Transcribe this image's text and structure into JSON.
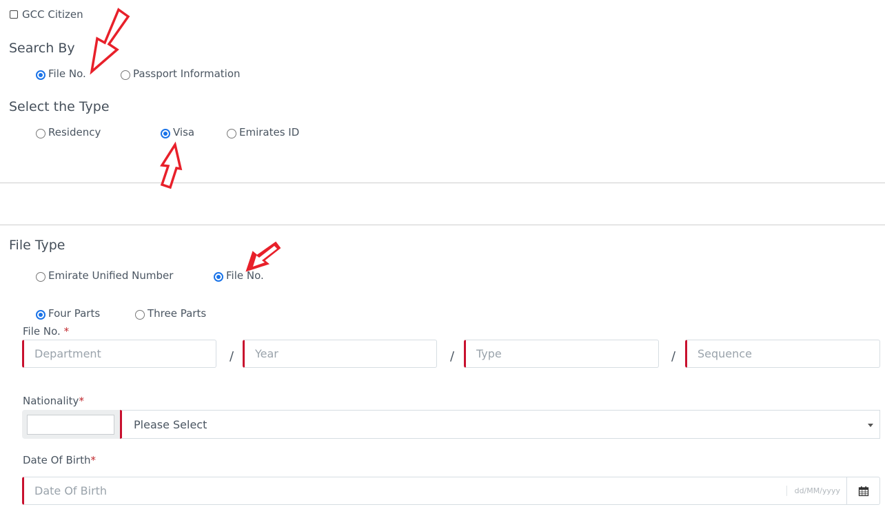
{
  "gcc": {
    "label": "GCC Citizen",
    "checked": false
  },
  "search_by": {
    "title": "Search By",
    "options": [
      {
        "label": "File No.",
        "selected": true
      },
      {
        "label": "Passport Information",
        "selected": false
      }
    ]
  },
  "select_type": {
    "title": "Select the Type",
    "options": [
      {
        "label": "Residency",
        "selected": false
      },
      {
        "label": "Visa",
        "selected": true
      },
      {
        "label": "Emirates ID",
        "selected": false
      }
    ]
  },
  "file_type": {
    "title": "File Type",
    "options": [
      {
        "label": "Emirate Unified Number",
        "selected": false
      },
      {
        "label": "File No.",
        "selected": true
      }
    ],
    "parts_options": [
      {
        "label": "Four Parts",
        "selected": true
      },
      {
        "label": "Three Parts",
        "selected": false
      }
    ]
  },
  "file_no": {
    "label": "File No.",
    "required_mark": "*",
    "separator": "/",
    "fields": [
      {
        "placeholder": "Department",
        "value": ""
      },
      {
        "placeholder": "Year",
        "value": ""
      },
      {
        "placeholder": "Type",
        "value": ""
      },
      {
        "placeholder": "Sequence",
        "value": ""
      }
    ]
  },
  "nationality": {
    "label": "Nationality",
    "required_mark": "*",
    "prefix_value": "",
    "selected": "Please Select"
  },
  "dob": {
    "label": "Date Of Birth",
    "required_mark": "*",
    "placeholder": "Date Of Birth",
    "format_hint": "dd/MM/yyyy",
    "value": ""
  },
  "colors": {
    "accent_blue": "#1a73e8",
    "required_red": "#c8102e",
    "annotation_arrow": "#e8202a"
  }
}
